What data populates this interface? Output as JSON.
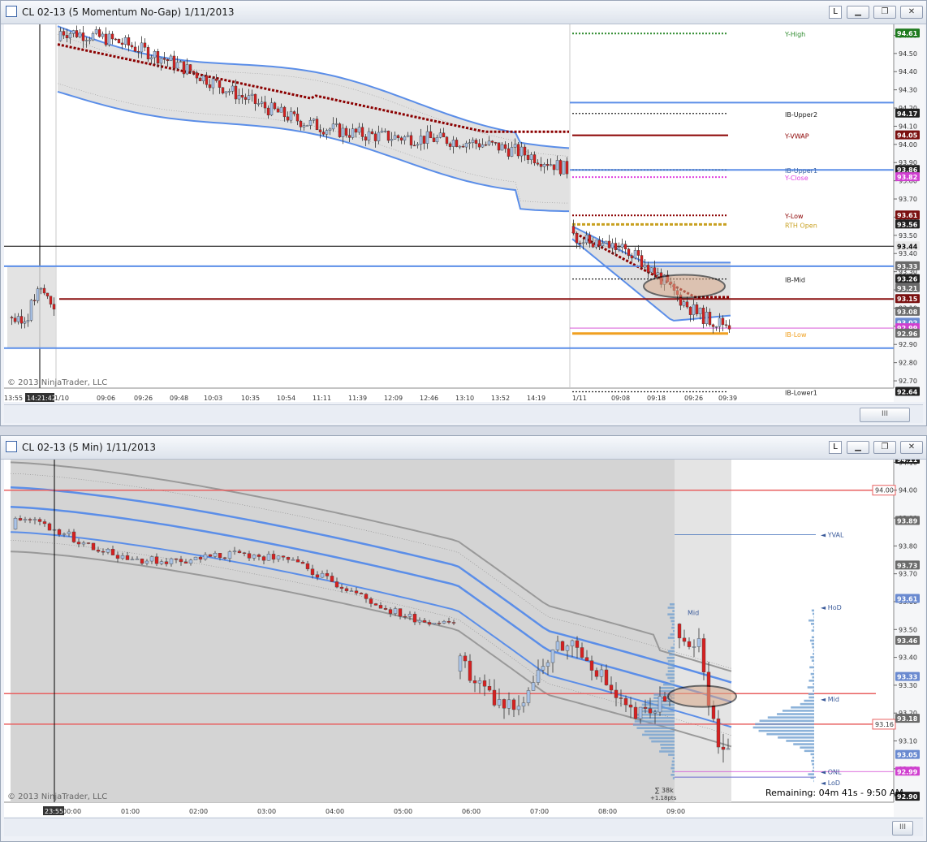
{
  "windows": {
    "top": {
      "title": "CL 02-13 (5 Momentum No-Gap)  1/11/2013",
      "l_label": "L",
      "copyright": "© 2013 NinjaTrader, LLC"
    },
    "bottom": {
      "title": "CL 02-13 (5 Min)  1/11/2013",
      "l_label": "L",
      "copyright": "© 2013 NinjaTrader, LLC",
      "remaining": "Remaining: 04m 41s - 9:50 AM",
      "sum_text": "∑ 38k",
      "sum_sub": "+1.18pts"
    }
  },
  "colors": {
    "blue_band": "#5b8ee8",
    "vwap": "#8b0000",
    "red_line": "#e86060",
    "orange": "#f0a020",
    "bull_fill": "#aac4e8",
    "bear_fill": "#d62020",
    "profile": "#6f9fd0"
  },
  "chart_data": [
    {
      "type": "candlestick",
      "name": "CL 02-13 (5 Momentum No-Gap)",
      "yticks": [
        "94.60",
        "94.50",
        "94.40",
        "94.30",
        "94.20",
        "94.10",
        "94.00",
        "93.90",
        "93.80",
        "93.70",
        "93.60",
        "93.50",
        "93.40",
        "93.30",
        "93.20",
        "93.10",
        "93.00",
        "92.90",
        "92.80",
        "92.70"
      ],
      "ylim": [
        92.66,
        94.66
      ],
      "xticks": [
        "13:55",
        "14:21:42",
        "1/10",
        "09:06",
        "09:26",
        "09:48",
        "10:03",
        "10:35",
        "10:54",
        "11:11",
        "11:39",
        "12:09",
        "12:46",
        "13:10",
        "13:52",
        "14:19",
        "1/11",
        "09:08",
        "09:18",
        "09:26",
        "09:39"
      ],
      "price_badges": [
        {
          "text": "94.61",
          "value": 94.61,
          "color": "#1e7a1e"
        },
        {
          "text": "94.17",
          "value": 94.17,
          "color": "#202020"
        },
        {
          "text": "94.05",
          "value": 94.05,
          "color": "#7a1010"
        },
        {
          "text": "93.86",
          "value": 93.86,
          "color": "#202020"
        },
        {
          "text": "93.82",
          "value": 93.82,
          "color": "#d040d0"
        },
        {
          "text": "93.61",
          "value": 93.61,
          "color": "#7a1010"
        },
        {
          "text": "93.56",
          "value": 93.56,
          "color": "#202020"
        },
        {
          "text": "93.44",
          "value": 93.44,
          "color": "#e8e8e8"
        },
        {
          "text": "93.33",
          "value": 93.33,
          "color": "#6a6a6a"
        },
        {
          "text": "93.26",
          "value": 93.26,
          "color": "#202020"
        },
        {
          "text": "93.21",
          "value": 93.21,
          "color": "#6a6a6a"
        },
        {
          "text": "93.15",
          "value": 93.15,
          "color": "#7a1010"
        },
        {
          "text": "93.08",
          "value": 93.08,
          "color": "#6a6a6a"
        },
        {
          "text": "93.02",
          "value": 93.02,
          "color": "#6a8ad0"
        },
        {
          "text": "92.99",
          "value": 92.99,
          "color": "#d040d0"
        },
        {
          "text": "92.96",
          "value": 92.96,
          "color": "#6a6a6a"
        },
        {
          "text": "92.64",
          "value": 92.64,
          "color": "#202020"
        }
      ],
      "levels": [
        {
          "label": "Y-High",
          "value": 94.61,
          "color": "#2e8b2e"
        },
        {
          "label": "IB-Upper2",
          "value": 94.17,
          "color": "#202020"
        },
        {
          "label": "Y-VWAP",
          "value": 94.05,
          "color": "#8b0000"
        },
        {
          "label": "IB-Upper1",
          "value": 93.86,
          "color": "#3a64a8"
        },
        {
          "label": "Y-Close",
          "value": 93.82,
          "color": "#d040d0"
        },
        {
          "label": "Y-Low",
          "value": 93.61,
          "color": "#8b0000"
        },
        {
          "label": "RTH Open",
          "value": 93.56,
          "color": "#202020"
        },
        {
          "label": "IB-Mid",
          "value": 93.26,
          "color": "#202020"
        },
        {
          "label": "IB-Low",
          "value": 92.96,
          "color": "#f0a020"
        },
        {
          "label": "IB-Lower1",
          "value": 92.64,
          "color": "#202020"
        }
      ]
    },
    {
      "type": "candlestick",
      "name": "CL 02-13 (5 Min)",
      "yticks": [
        "94.10",
        "94.00",
        "93.90",
        "93.80",
        "93.70",
        "93.60",
        "93.50",
        "93.40",
        "93.30",
        "93.20",
        "93.10",
        "93.00",
        "92.90"
      ],
      "ylim": [
        92.88,
        94.11
      ],
      "xticks": [
        "23:55",
        "00:00",
        "01:00",
        "02:00",
        "03:00",
        "04:00",
        "05:00",
        "06:00",
        "07:00",
        "08:00",
        "09:00"
      ],
      "price_badges": [
        {
          "text": "94.11",
          "value": 94.11,
          "color": "#202020"
        },
        {
          "text": "93.89",
          "value": 93.89,
          "color": "#6a6a6a"
        },
        {
          "text": "93.73",
          "value": 93.73,
          "color": "#6a6a6a"
        },
        {
          "text": "93.61",
          "value": 93.61,
          "color": "#6a8ad0"
        },
        {
          "text": "93.46",
          "value": 93.46,
          "color": "#6a6a6a"
        },
        {
          "text": "93.33",
          "value": 93.33,
          "color": "#6a8ad0"
        },
        {
          "text": "93.18",
          "value": 93.18,
          "color": "#6a6a6a"
        },
        {
          "text": "93.05",
          "value": 93.05,
          "color": "#6a8ad0"
        },
        {
          "text": "92.99",
          "value": 92.99,
          "color": "#d040d0"
        },
        {
          "text": "92.90",
          "value": 92.9,
          "color": "#202020"
        }
      ],
      "red_lines": [
        {
          "value": 94.0,
          "text": "94.00"
        },
        {
          "value": 93.16,
          "text": "93.16"
        }
      ],
      "profile_labels": [
        {
          "text": "YVAL",
          "value": 93.84
        },
        {
          "text": "HoD",
          "value": 93.58
        },
        {
          "text": "Mid",
          "value": 93.56
        },
        {
          "text": "Mid",
          "value": 93.25
        },
        {
          "text": "ONL",
          "value": 92.99
        },
        {
          "text": "LoD",
          "value": 92.95
        }
      ]
    }
  ]
}
